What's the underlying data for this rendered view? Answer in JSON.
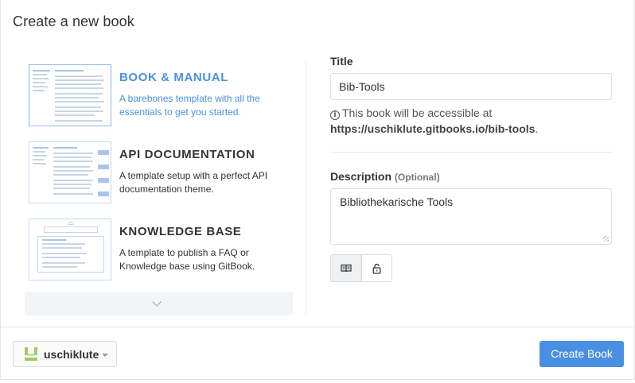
{
  "dialog": {
    "title": "Create a new book"
  },
  "templates": [
    {
      "name": "BOOK & MANUAL",
      "description": "A barebones template with all the essentials to get you started.",
      "selected": true
    },
    {
      "name": "API DOCUMENTATION",
      "description": "A template setup with a perfect API documentation theme.",
      "selected": false
    },
    {
      "name": "KNOWLEDGE BASE",
      "description": "A template to publish a FAQ or Knowledge base using GitBook.",
      "selected": false
    }
  ],
  "more_templates": {
    "icon": "chevron-down-icon"
  },
  "form": {
    "title_label": "Title",
    "title_value": "Bib-Tools",
    "help_prefix": "This book will be accessible at",
    "help_url": "https://uschiklute.gitbooks.io/bib-tools",
    "help_suffix": ".",
    "description_label": "Description",
    "description_optional": "(Optional)",
    "description_value": "Bibliothekarische Tools",
    "visibility_buttons": [
      {
        "icon": "book-icon",
        "active": true
      },
      {
        "icon": "lock-icon",
        "active": false
      }
    ]
  },
  "footer": {
    "owner": "uschiklute",
    "create_label": "Create Book"
  },
  "colors": {
    "accent": "#4a90e2",
    "avatar_green": "#9ccc65"
  }
}
